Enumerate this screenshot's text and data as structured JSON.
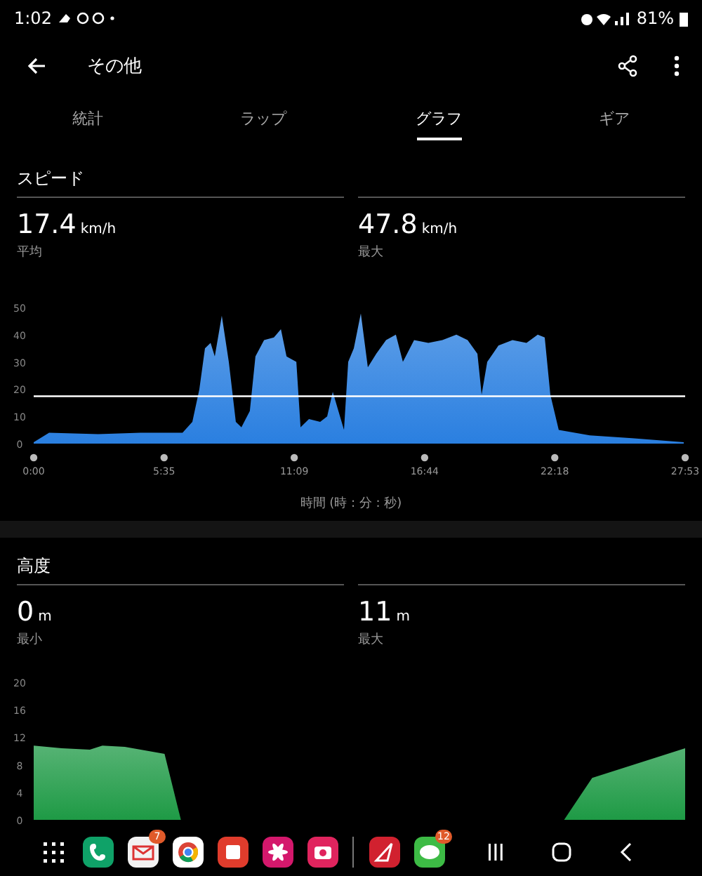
{
  "status_bar": {
    "time": "1:02",
    "battery": "81%"
  },
  "app_bar": {
    "title": "その他"
  },
  "tabs": [
    {
      "label": "統計",
      "selected": false
    },
    {
      "label": "ラップ",
      "selected": false
    },
    {
      "label": "グラフ",
      "selected": true
    },
    {
      "label": "ギア",
      "selected": false
    }
  ],
  "speed": {
    "title": "スピード",
    "stats": [
      {
        "value": "17.4",
        "unit": "km/h",
        "label": "平均"
      },
      {
        "value": "47.8",
        "unit": "km/h",
        "label": "最大"
      }
    ],
    "chart_data": {
      "type": "area",
      "xlabel": "時間 (時 : 分 : 秒)",
      "x": [
        0,
        0.66,
        2.76,
        4.57,
        6.37,
        6.79,
        7.09,
        7.33,
        7.57,
        7.75,
        8.05,
        8.35,
        8.65,
        8.89,
        9.25,
        9.49,
        9.86,
        10.28,
        10.58,
        10.82,
        11.24,
        11.42,
        11.78,
        12.26,
        12.56,
        12.8,
        13.04,
        13.28,
        13.46,
        13.7,
        14.0,
        14.3,
        14.66,
        15.08,
        15.5,
        15.8,
        16.28,
        16.89,
        17.49,
        18.09,
        18.57,
        18.99,
        19.17,
        19.41,
        19.89,
        20.49,
        21.09,
        21.57,
        21.87,
        22.11,
        22.47,
        23.8,
        25.6,
        27.82
      ],
      "series": [
        {
          "color": "#2a7fe0",
          "values": [
            0.5,
            4,
            3.5,
            4,
            4,
            8,
            20,
            35,
            37,
            32,
            47,
            30,
            8,
            6,
            12,
            32,
            38,
            39,
            42,
            32,
            30,
            6,
            9,
            8,
            10,
            19,
            12,
            5,
            30,
            35,
            47.8,
            28,
            33,
            38,
            40,
            30,
            38,
            37,
            38,
            40,
            38,
            33,
            18,
            30,
            36,
            38,
            37,
            40,
            39,
            18,
            5,
            3,
            2,
            0.5
          ]
        }
      ],
      "xlim": [
        0,
        27.88
      ],
      "ylim": [
        0,
        50
      ],
      "xticks": [
        {
          "value": 0,
          "label": "0:00"
        },
        {
          "value": 5.58,
          "label": "5:35"
        },
        {
          "value": 11.15,
          "label": "11:09"
        },
        {
          "value": 16.73,
          "label": "16:44"
        },
        {
          "value": 22.3,
          "label": "22:18"
        },
        {
          "value": 27.88,
          "label": "27:53"
        }
      ],
      "yticks": [
        0,
        10,
        20,
        30,
        40,
        50
      ],
      "ref_lines": [
        {
          "axis": "y",
          "value": 17.4
        }
      ]
    }
  },
  "altitude": {
    "title": "高度",
    "stats": [
      {
        "value": "0",
        "unit": "m",
        "label": "最小"
      },
      {
        "value": "11",
        "unit": "m",
        "label": "最大"
      }
    ],
    "chart_data": {
      "type": "area",
      "x": [
        0,
        1.2,
        2.4,
        2.94,
        3.9,
        5.6,
        6.3,
        22.7,
        23.9,
        27.88
      ],
      "series": [
        {
          "color": "#1e9a45",
          "values": [
            10.8,
            10.4,
            10.2,
            10.8,
            10.6,
            9.6,
            0,
            0,
            6.1,
            10.4
          ]
        }
      ],
      "xlim": [
        0,
        27.88
      ],
      "ylim": [
        0,
        20
      ],
      "yticks": [
        0,
        4,
        8,
        12,
        16,
        20
      ]
    }
  },
  "dock": {
    "apps": [
      {
        "kind": "grid"
      },
      {
        "kind": "phone"
      },
      {
        "kind": "mail",
        "badge": "7"
      },
      {
        "kind": "browser"
      },
      {
        "kind": "notes"
      },
      {
        "kind": "flower"
      },
      {
        "kind": "camera"
      },
      {
        "kind": "divider"
      },
      {
        "kind": "compass"
      },
      {
        "kind": "chat",
        "badge": "12"
      }
    ]
  }
}
